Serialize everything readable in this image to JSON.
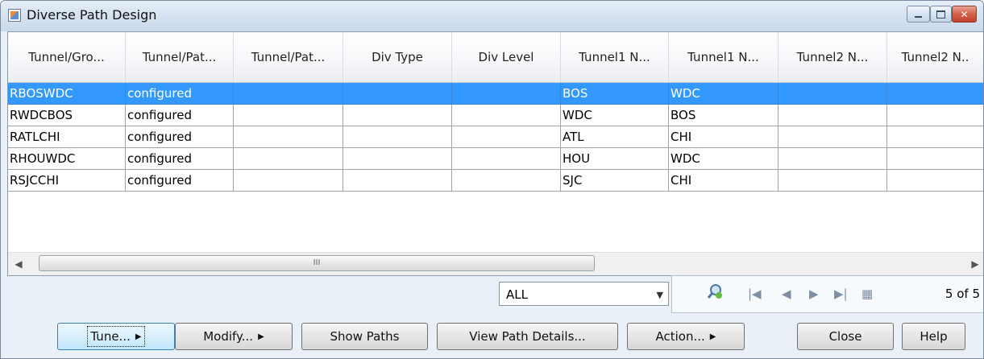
{
  "window": {
    "title": "Diverse Path Design"
  },
  "table": {
    "columns": [
      "Tunnel/Gro...",
      "Tunnel/Pat...",
      "Tunnel/Pat...",
      "Div Type",
      "Div Level",
      "Tunnel1 N...",
      "Tunnel1 N...",
      "Tunnel2 N...",
      "Tunnel2 N.."
    ],
    "rows": [
      [
        "RBOSWDC",
        "configured",
        "",
        "",
        "",
        "BOS",
        "WDC",
        "",
        ""
      ],
      [
        "RWDCBOS",
        "configured",
        "",
        "",
        "",
        "WDC",
        "BOS",
        "",
        ""
      ],
      [
        "RATLCHI",
        "configured",
        "",
        "",
        "",
        "ATL",
        "CHI",
        "",
        ""
      ],
      [
        "RHOUWDC",
        "configured",
        "",
        "",
        "",
        "HOU",
        "WDC",
        "",
        ""
      ],
      [
        "RSJCCHI",
        "configured",
        "",
        "",
        "",
        "SJC",
        "CHI",
        "",
        ""
      ]
    ],
    "selected_row": 0,
    "scroll_grip": "III"
  },
  "filter": {
    "value": "ALL"
  },
  "navigation": {
    "page_count": "5 of 5"
  },
  "buttons": {
    "tune": "Tune...",
    "modify": "Modify...",
    "show_paths": "Show Paths",
    "view_path_details": "View Path Details...",
    "action": "Action...",
    "close": "Close",
    "help": "Help"
  },
  "colors": {
    "selection": "#3399ff",
    "window_bg": "#e9f0f8"
  }
}
